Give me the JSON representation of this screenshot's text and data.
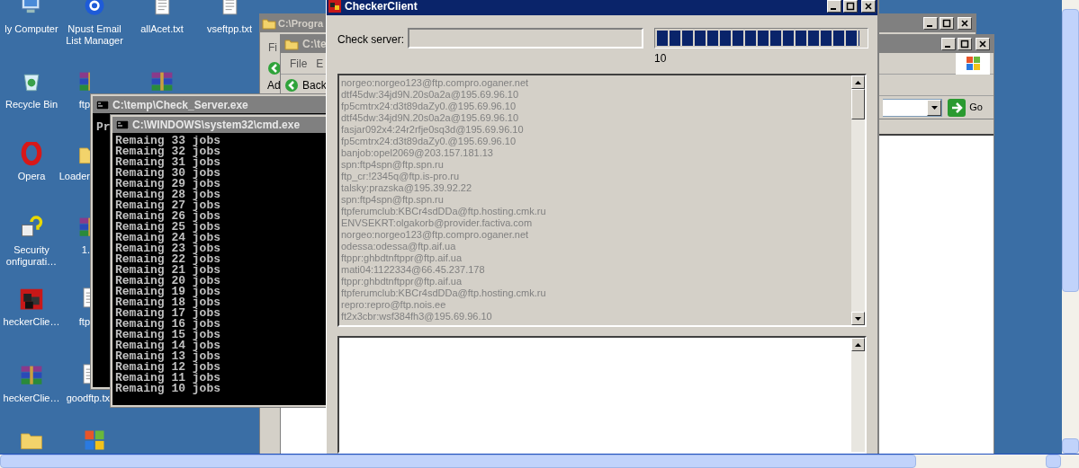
{
  "desktop_icons": [
    {
      "label": "ly Computer",
      "kind": "computer"
    },
    {
      "label": "Npust Email List Manager",
      "kind": "email"
    },
    {
      "label": "allAcet.txt",
      "kind": "text"
    },
    {
      "label": "vseftpp.txt",
      "kind": "text"
    },
    {
      "label": "Recycle Bin",
      "kind": "recycle"
    },
    {
      "label": "ftp",
      "kind": "archive"
    },
    {
      "kind": "archive"
    },
    {
      "label": "Opera",
      "kind": "opera"
    },
    {
      "label": "Loader",
      "kind": "folder"
    },
    {
      "label": "Security onfigurati…",
      "kind": "help"
    },
    {
      "label": "1.",
      "kind": "archive"
    },
    {
      "label": "heckerClie…",
      "kind": "cubes"
    },
    {
      "label": "ftp",
      "kind": "text"
    },
    {
      "label": "heckerClie…",
      "kind": "archive"
    },
    {
      "label": "goodftp.tx",
      "kind": "text"
    },
    {
      "kind": "folder"
    },
    {
      "kind": "windows"
    }
  ],
  "explorer_back": {
    "title": "C:\\Progra",
    "menu": "Fi",
    "toolbar_label": "Ad"
  },
  "explorer_front": {
    "title": "C:\\te",
    "menu": [
      "File",
      "E"
    ],
    "back_button": "Back",
    "go_button": "Go"
  },
  "console_back": {
    "title": "C:\\temp\\Check_Server.exe",
    "text": "Pr"
  },
  "cmd": {
    "title": "C:\\WINDOWS\\system32\\cmd.exe",
    "lines": [
      "Remaing 33 jobs",
      "Remaing 32 jobs",
      "Remaing 31 jobs",
      "Remaing 30 jobs",
      "Remaing 29 jobs",
      "Remaing 28 jobs",
      "Remaing 27 jobs",
      "Remaing 26 jobs",
      "Remaing 25 jobs",
      "Remaing 24 jobs",
      "Remaing 23 jobs",
      "Remaing 22 jobs",
      "Remaing 21 jobs",
      "Remaing 20 jobs",
      "Remaing 19 jobs",
      "Remaing 18 jobs",
      "Remaing 17 jobs",
      "Remaing 16 jobs",
      "Remaing 15 jobs",
      "Remaing 14 jobs",
      "Remaing 13 jobs",
      "Remaing 12 jobs",
      "Remaing 11 jobs",
      "Remaing 10 jobs"
    ]
  },
  "checker": {
    "title": "CheckerClient",
    "check_server_label": "Check server:",
    "progress": {
      "level": 0.97,
      "reading": "10"
    },
    "log": [
      "norgeo:norgeo123@ftp.compro.oganer.net",
      "dtf45dw:34jd9N.20s0a2a@195.69.96.10",
      "fp5cmtrx24:d3t89daZy0.@195.69.96.10",
      "dtf45dw:34jd9N.20s0a2a@195.69.96.10",
      "fasjar092x4:24r2rfje0sq3d@195.69.96.10",
      "fp5cmtrx24:d3t89daZy0.@195.69.96.10",
      "banjob:opel2069@203.157.181.13",
      "spn:ftp4spn@ftp.spn.ru",
      "ftp_cr:!2345q@ftp.is-pro.ru",
      "talsky:prazska@195.39.92.22",
      "spn:ftp4spn@ftp.spn.ru",
      "ftpferumclub:KBCr4sdDDa@ftp.hosting.cmk.ru",
      "ENVSEKRT:olgakorb@provider.factiva.com",
      "norgeo:norgeo123@ftp.compro.oganer.net",
      "odessa:odessa@ftp.aif.ua",
      "ftppr:ghbdtnftppr@ftp.aif.ua",
      "mati04:1122334@66.45.237.178",
      "ftppr:ghbdtnftppr@ftp.aif.ua",
      "ftpferumclub:KBCr4sdDDa@ftp.hosting.cmk.ru",
      "repro:repro@ftp.nois.ee",
      "ft2x3cbr:wsf384fh3@195.69.96.10"
    ]
  }
}
